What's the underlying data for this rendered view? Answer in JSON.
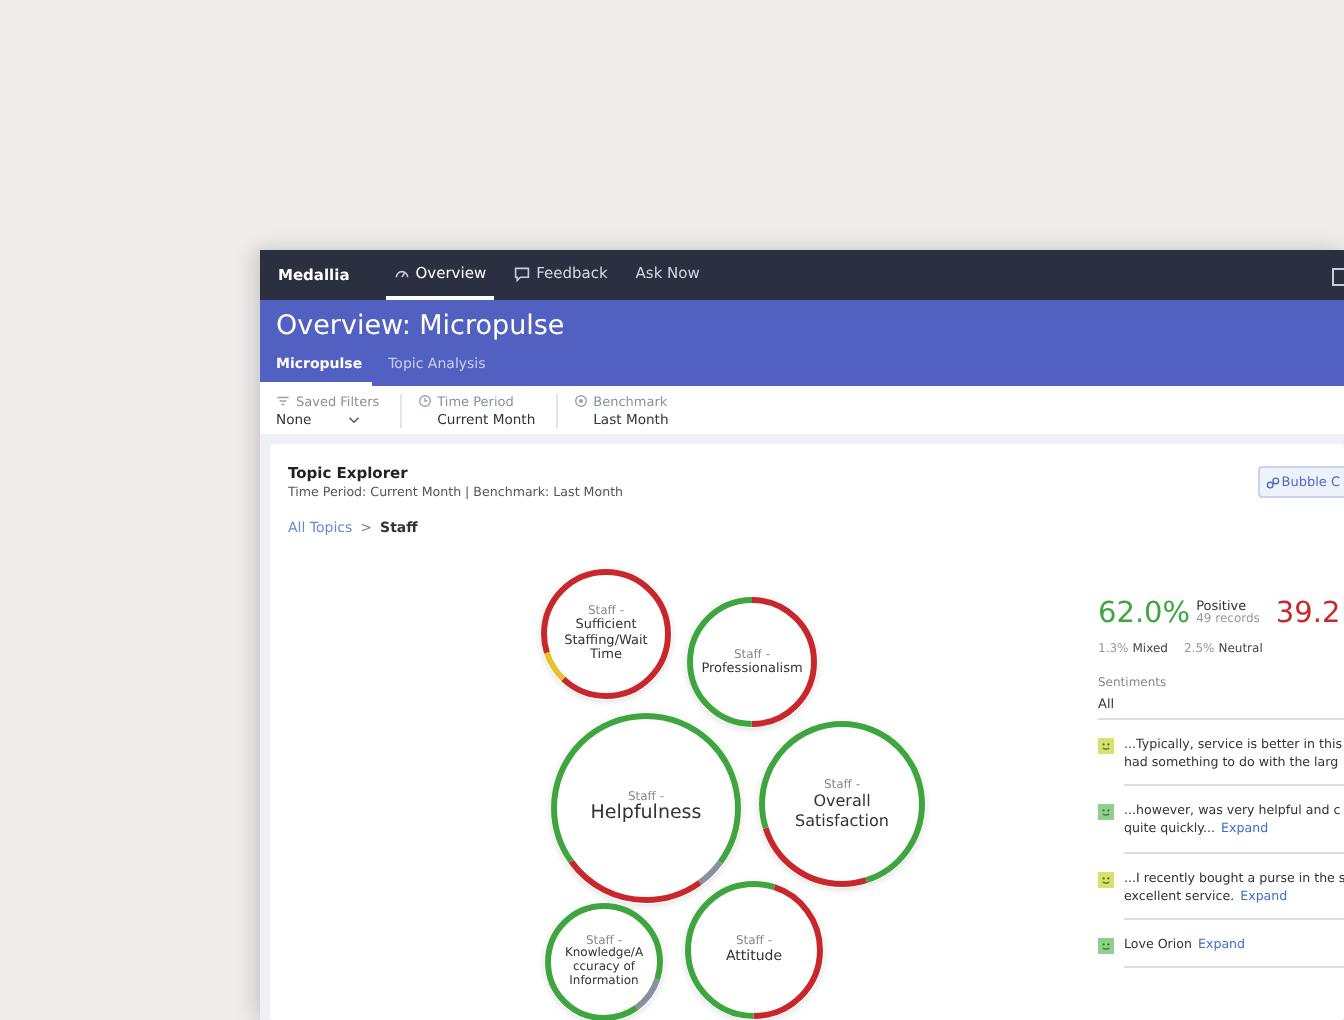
{
  "nav": {
    "brand": "Medallia",
    "items": [
      {
        "label": "Overview",
        "selected": true
      },
      {
        "label": "Feedback",
        "selected": false
      },
      {
        "label": "Ask Now",
        "selected": false
      }
    ]
  },
  "header": {
    "title": "Overview: Micropulse",
    "tabs": [
      {
        "label": "Micropulse",
        "selected": true
      },
      {
        "label": "Topic Analysis",
        "selected": false
      }
    ]
  },
  "filters": [
    {
      "label": "Saved Filters",
      "value": "None"
    },
    {
      "label": "Time Period",
      "value": "Current Month"
    },
    {
      "label": "Benchmark",
      "value": "Last Month"
    }
  ],
  "card": {
    "title": "Topic Explorer",
    "subtitle": "Time Period: Current Month | Benchmark: Last Month",
    "view_button": "Bubble C",
    "breadcrumb": {
      "parent": "All Topics",
      "separator": ">",
      "current": "Staff"
    },
    "bubbles": [
      {
        "prefix": "Staff -",
        "name": "Sufficient Staffing/Wait Time",
        "arcs": [
          {
            "kind": "negative",
            "level": 0.62
          },
          {
            "kind": "mixed",
            "level": 0.08
          },
          {
            "kind": "negative",
            "level": 0.3
          }
        ]
      },
      {
        "prefix": "Staff -",
        "name": "Professionalism",
        "arcs": [
          {
            "kind": "negative",
            "level": 0.5
          },
          {
            "kind": "positive",
            "level": 0.5
          }
        ]
      },
      {
        "prefix": "Staff -",
        "name": "Helpfulness",
        "arcs": [
          {
            "kind": "positive",
            "level": 0.35
          },
          {
            "kind": "neutral",
            "level": 0.05
          },
          {
            "kind": "negative",
            "level": 0.25
          },
          {
            "kind": "positive",
            "level": 0.35
          }
        ]
      },
      {
        "prefix": "Staff -",
        "name": "Overall Satisfaction",
        "arcs": [
          {
            "kind": "positive",
            "level": 0.45
          },
          {
            "kind": "negative",
            "level": 0.25
          },
          {
            "kind": "positive",
            "level": 0.3
          }
        ]
      },
      {
        "prefix": "Staff -",
        "name": "Knowledge/A ccuracy of Information",
        "arcs": [
          {
            "kind": "positive",
            "level": 0.3
          },
          {
            "kind": "neutral",
            "level": 0.1
          },
          {
            "kind": "positive",
            "level": 0.6
          }
        ]
      },
      {
        "prefix": "Staff -",
        "name": "Attitude",
        "arcs": [
          {
            "kind": "positive",
            "level": 0.05
          },
          {
            "kind": "negative",
            "level": 0.45
          },
          {
            "kind": "positive",
            "level": 0.5
          }
        ]
      }
    ],
    "stats": {
      "positive_pct": "62.0%",
      "positive_label": "Positive",
      "records": "49 records",
      "negative_pct": "39.2",
      "mixed_pct": "1.3%",
      "mixed_label": "Mixed",
      "neutral_pct": "2.5%",
      "neutral_label": "Neutral"
    },
    "sentiments": {
      "label": "Sentiments",
      "value": "All"
    },
    "comments": [
      {
        "color": "#d8e070",
        "lines": [
          "...Typically, service is better in this",
          "had something to do with the larg"
        ]
      },
      {
        "color": "#8fd08f",
        "lines": [
          "...however, was very helpful and c",
          "quite quickly..."
        ],
        "expand": "Expand"
      },
      {
        "color": "#d8e070",
        "lines": [
          "...I recently bought a purse in the s",
          "excellent service."
        ],
        "expand": "Expand"
      },
      {
        "color": "#8fd08f",
        "lines": [
          "Love Orion"
        ],
        "expand": "Expand"
      }
    ]
  }
}
